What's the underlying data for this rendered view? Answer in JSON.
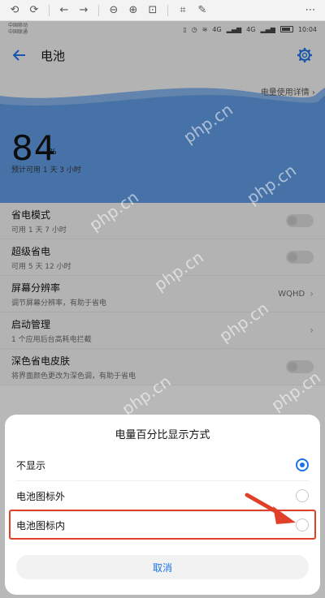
{
  "viewer": {
    "buttons": [
      "rotate-left-icon",
      "rotate-right-icon",
      "back-icon",
      "forward-icon",
      "zoom-out-icon",
      "zoom-in-icon",
      "fit-icon",
      "crop-icon",
      "magic-icon",
      "more-icon"
    ]
  },
  "statusbar": {
    "carrier_line1": "中国移动",
    "carrier_line2": "中国联通",
    "signal_1": "4G",
    "signal_2": "4G",
    "time": "10:04"
  },
  "appbar": {
    "title": "电池"
  },
  "hero": {
    "usage_link": "电量使用详情 ›",
    "percent_value": "84",
    "percent_sign": "%",
    "estimate": "预计可用 1 天 3 小时",
    "colors": {
      "wave": "#5b93d6",
      "wave_light": "#7ea9de"
    }
  },
  "settings": [
    {
      "title": "省电模式",
      "sub": "可用 1 天 7 小时",
      "control": "toggle"
    },
    {
      "title": "超级省电",
      "sub": "可用 5 天 12 小时",
      "control": "toggle"
    },
    {
      "title": "屏幕分辨率",
      "sub": "调节屏幕分辨率，有助于省电",
      "control": "value",
      "value": "WQHD"
    },
    {
      "title": "启动管理",
      "sub": "1 个应用后台高耗电拦截",
      "control": "chevron"
    },
    {
      "title": "深色省电皮肤",
      "sub": "将界面颜色更改为深色调，有助于省电",
      "control": "toggle"
    }
  ],
  "dialog": {
    "title": "电量百分比显示方式",
    "options": [
      {
        "label": "不显示",
        "selected": true
      },
      {
        "label": "电池图标外",
        "selected": false
      },
      {
        "label": "电池图标内",
        "selected": false
      }
    ],
    "cancel_label": "取消",
    "accent": "#1a73e8",
    "highlight_color": "#e0402a"
  },
  "watermark": "php.cn"
}
